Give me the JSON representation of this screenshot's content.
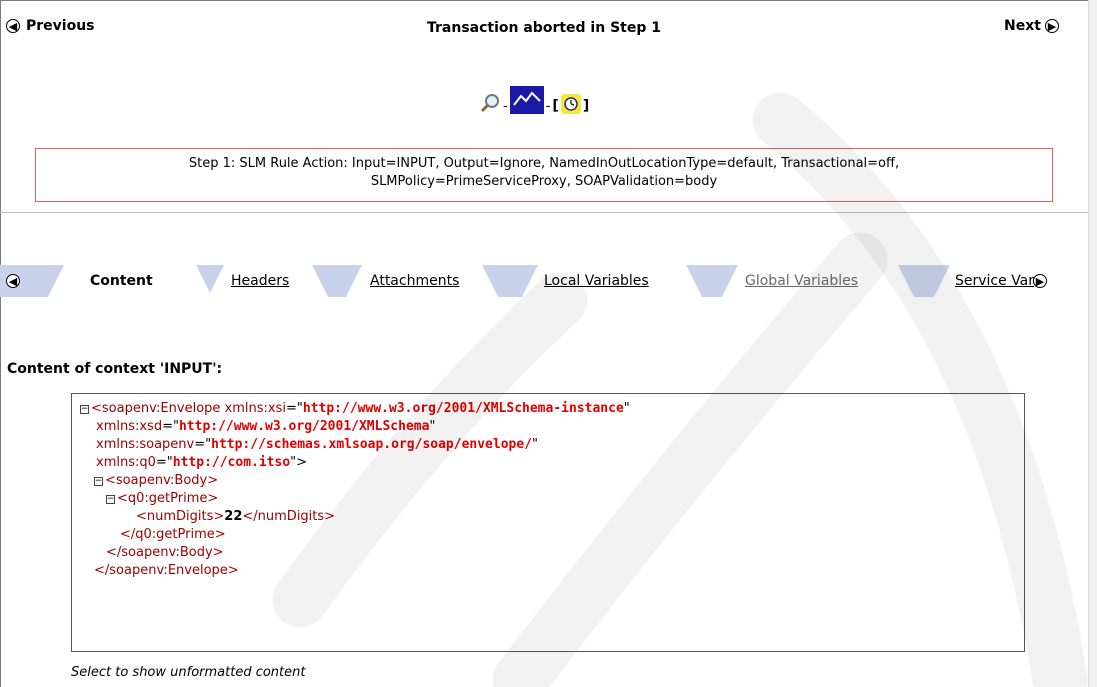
{
  "nav": {
    "previous_label": "Previous",
    "next_label": "Next",
    "title": "Transaction aborted in Step 1"
  },
  "toolbar": {
    "icons": [
      "magnifier-icon",
      "chart-icon",
      "clock-icon"
    ],
    "separator": "-",
    "bracket_open": "[",
    "bracket_close": "]"
  },
  "step": {
    "line1": "Step 1: SLM Rule Action: Input=INPUT, Output=Ignore, NamedInOutLocationType=default, Transactional=off,",
    "line2": "SLMPolicy=PrimeServiceProxy, SOAPValidation=body"
  },
  "tabs": [
    {
      "label": "Content",
      "state": "active"
    },
    {
      "label": "Headers",
      "state": "link"
    },
    {
      "label": "Attachments",
      "state": "link"
    },
    {
      "label": "Local Variables",
      "state": "link"
    },
    {
      "label": "Global Variables",
      "state": "disabled"
    },
    {
      "label": "Service Var",
      "state": "link"
    }
  ],
  "content": {
    "heading": "Content of context 'INPUT':",
    "xml": {
      "envelope_open": "<soapenv:Envelope",
      "xmlns_xsi_name": "xmlns:xsi",
      "xmlns_xsi_value": "http://www.w3.org/2001/XMLSchema-instance",
      "xmlns_xsd_name": "xmlns:xsd",
      "xmlns_xsd_value": "http://www.w3.org/2001/XMLSchema",
      "xmlns_soapenv_name": "xmlns:soapenv",
      "xmlns_soapenv_value": "http://schemas.xmlsoap.org/soap/envelope/",
      "xmlns_q0_name": "xmlns:q0",
      "xmlns_q0_value": "http://com.itso",
      "body_open": "<soapenv:Body>",
      "getprime_open": "<q0:getPrime>",
      "numdigits_open": "<numDigits>",
      "numdigits_value": "22",
      "numdigits_close": "</numDigits>",
      "getprime_close": "</q0:getPrime>",
      "body_close": "</soapenv:Body>",
      "envelope_close": "</soapenv:Envelope>"
    },
    "footer": "Select to show unformatted content"
  },
  "colors": {
    "tab_strip": "#c8d2ea",
    "step_border": "#e06060",
    "attr_value": "#e00000",
    "tag": "#990000"
  }
}
